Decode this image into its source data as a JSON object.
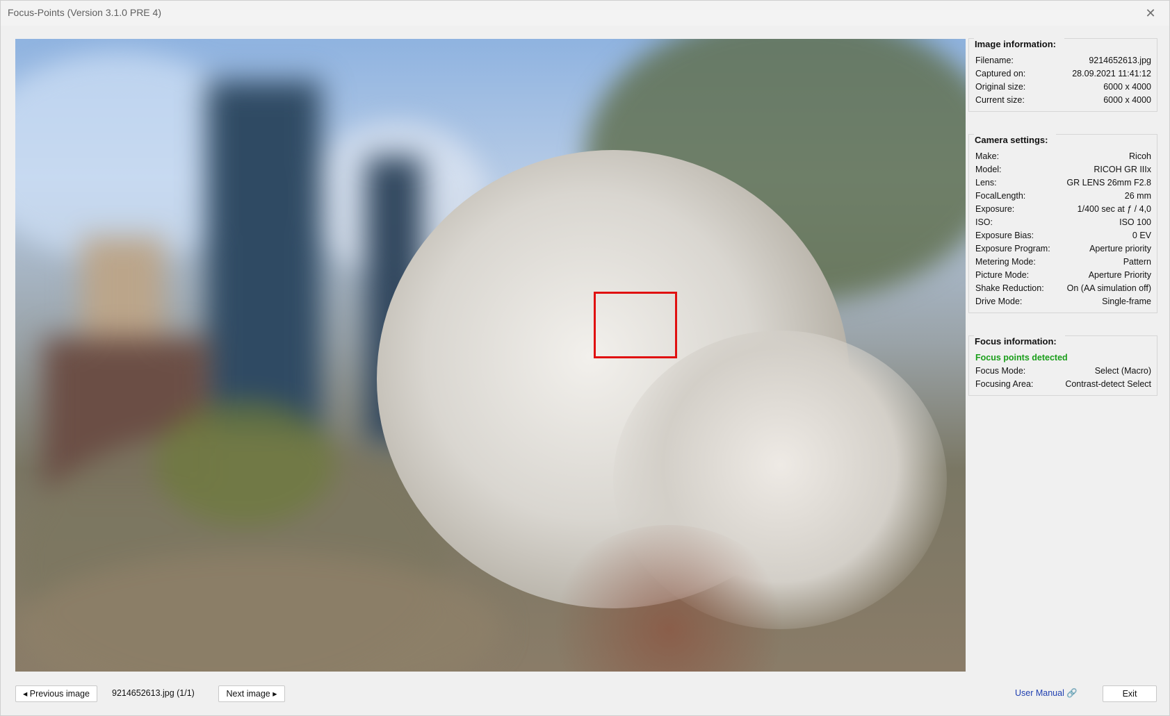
{
  "window": {
    "title": "Focus-Points (Version 3.1.0 PRE 4)",
    "close_glyph": "✕"
  },
  "image_info": {
    "heading": "Image information:",
    "rows": [
      {
        "label": "Filename:",
        "value": "9214652613.jpg"
      },
      {
        "label": "Captured on:",
        "value": "28.09.2021 11:41:12"
      },
      {
        "label": "Original size:",
        "value": "6000 x 4000"
      },
      {
        "label": "Current size:",
        "value": "6000 x 4000"
      }
    ]
  },
  "camera_settings": {
    "heading": "Camera settings:",
    "rows": [
      {
        "label": "Make:",
        "value": "Ricoh"
      },
      {
        "label": "Model:",
        "value": "RICOH GR IIIx"
      },
      {
        "label": "Lens:",
        "value": "GR LENS 26mm F2.8"
      },
      {
        "label": "FocalLength:",
        "value": "26 mm"
      },
      {
        "label": "Exposure:",
        "value": "1/400 sec at ƒ / 4,0"
      },
      {
        "label": "ISO:",
        "value": "ISO 100"
      },
      {
        "label": "Exposure Bias:",
        "value": "0 EV"
      },
      {
        "label": "Exposure Program:",
        "value": "Aperture priority"
      },
      {
        "label": "Metering Mode:",
        "value": "Pattern"
      },
      {
        "label": "Picture Mode:",
        "value": "Aperture Priority"
      },
      {
        "label": "Shake Reduction:",
        "value": "On (AA simulation off)"
      },
      {
        "label": "Drive Mode:",
        "value": "Single-frame"
      }
    ]
  },
  "focus_info": {
    "heading": "Focus information:",
    "status": "Focus points detected",
    "status_color": "#1a9e1a",
    "rows": [
      {
        "label": "Focus Mode:",
        "value": "Select (Macro)"
      },
      {
        "label": "Focusing Area:",
        "value": "Contrast-detect Select"
      }
    ]
  },
  "footer": {
    "prev_label": "◂ Previous image",
    "file_counter": "9214652613.jpg (1/1)",
    "next_label": "Next image ▸",
    "manual_label": "User Manual 🔗",
    "exit_label": "Exit"
  },
  "colors": {
    "focus_frame": "#e01010",
    "link": "#1f3fb0"
  }
}
